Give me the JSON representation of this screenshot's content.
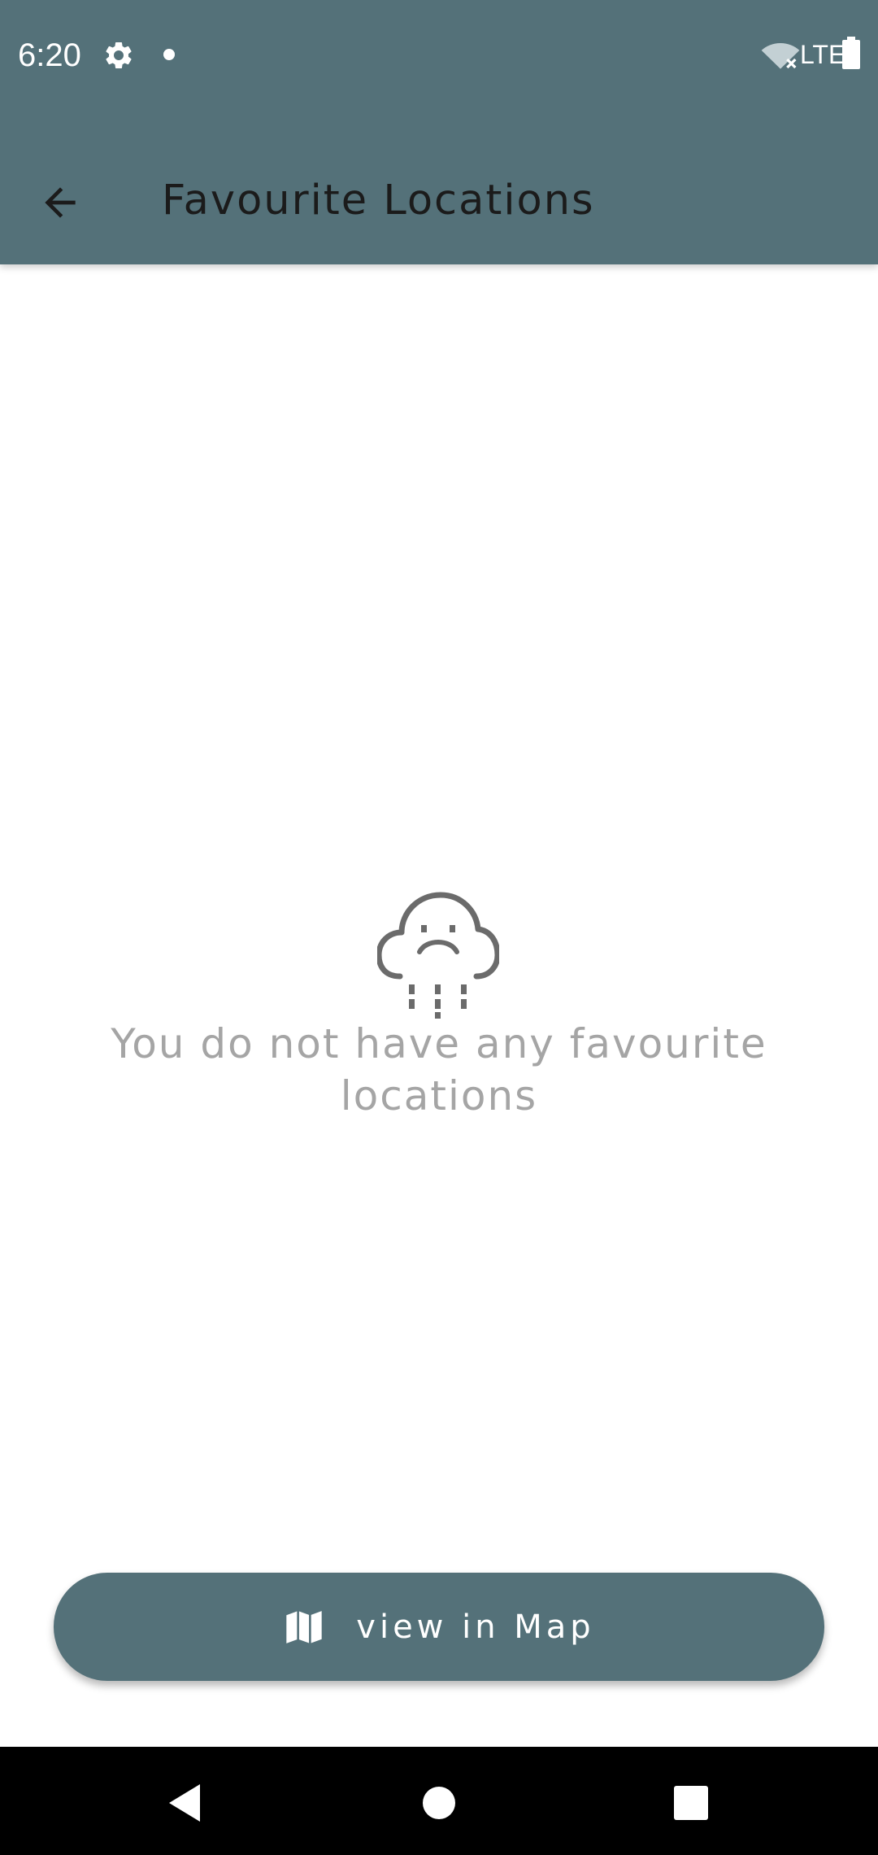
{
  "status_bar": {
    "time": "6:20",
    "network": "LTE",
    "icons": [
      "gear-icon",
      "notification-dot-icon",
      "wifi-off-icon",
      "battery-icon"
    ]
  },
  "toolbar": {
    "title": "Favourite Locations",
    "back_icon": "arrow-back-icon"
  },
  "empty_state": {
    "icon": "sad-cloud-icon",
    "message": "You do not have any favourite locations"
  },
  "map_button": {
    "icon": "map-icon",
    "label": "view in Map"
  },
  "nav_bar": {
    "icons": [
      "back-triangle-icon",
      "home-circle-icon",
      "recents-square-icon"
    ]
  },
  "colors": {
    "primary": "#547179",
    "title_text": "#1b1b1b",
    "empty_text": "#a5a5a5",
    "empty_icon": "#6b6b6b",
    "nav_bar": "#000000"
  }
}
